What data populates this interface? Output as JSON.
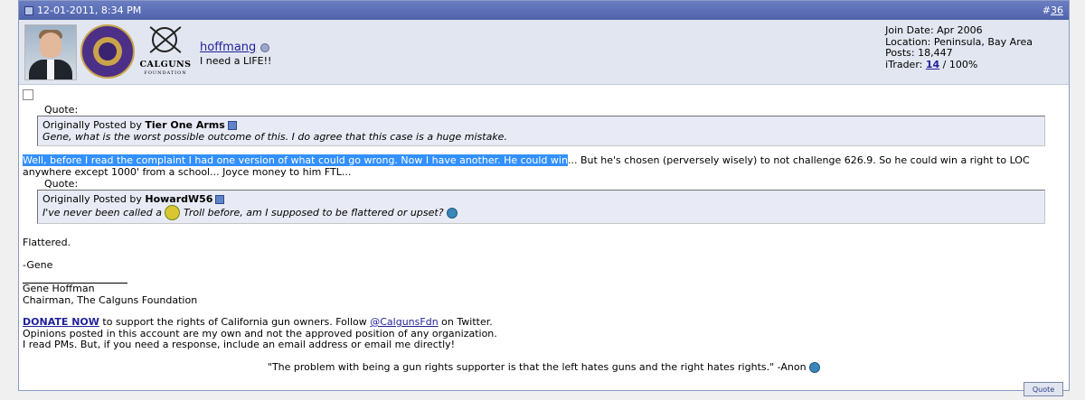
{
  "header": {
    "date": "12-01-2011, 8:34 PM",
    "post_number_prefix": "#",
    "post_number": "36"
  },
  "user": {
    "logo_word": "CALGUNS",
    "logo_sub": "FOUNDATION",
    "username": "hoffmang",
    "title": "I need a LIFE!!",
    "join_date": "Join Date: Apr 2006",
    "location": "Location: Peninsula, Bay Area",
    "posts": "Posts: 18,447",
    "itrader_label": "iTrader: ",
    "itrader_count": "14",
    "itrader_percent": " / 100%"
  },
  "quote1": {
    "label": "Quote:",
    "originally_posted_by": "Originally Posted by ",
    "author": "Tier One Arms",
    "text": "Gene, what is the worst possible outcome of this. I do agree that this case is a huge mistake."
  },
  "message": {
    "highlighted": "Well, before I read the complaint I had one version of what could go wrong. Now I have another. He could win",
    "rest": "... But he's chosen (perversely wisely) to not challenge 626.9. So he could win a right to LOC anywhere except 1000' from a school... Joyce money to him FTL..."
  },
  "quote2": {
    "label": "Quote:",
    "originally_posted_by": "Originally Posted by ",
    "author": "HowardW56",
    "text_before": "I've never been called a ",
    "text_after": " Troll before, am I supposed to be flattered or upset? "
  },
  "reply": {
    "flattered": "Flattered.",
    "gene": "-Gene"
  },
  "signature": {
    "name": "Gene Hoffman",
    "role": "Chairman, The Calguns Foundation",
    "donate": "DONATE NOW",
    "donate_rest": " to support the rights of California gun owners. Follow ",
    "twitter": "@CalgunsFdn",
    "twitter_rest": " on Twitter.",
    "line2": "Opinions posted in this account are my own and not the approved position of any organization.",
    "line3": "I read PMs. But, if you need a response, include an email address or email me directly!",
    "quote": "\"The problem with being a gun rights supporter is that the left hates guns and the right hates rights.\" -Anon "
  },
  "buttons": {
    "quote": "Quote"
  }
}
